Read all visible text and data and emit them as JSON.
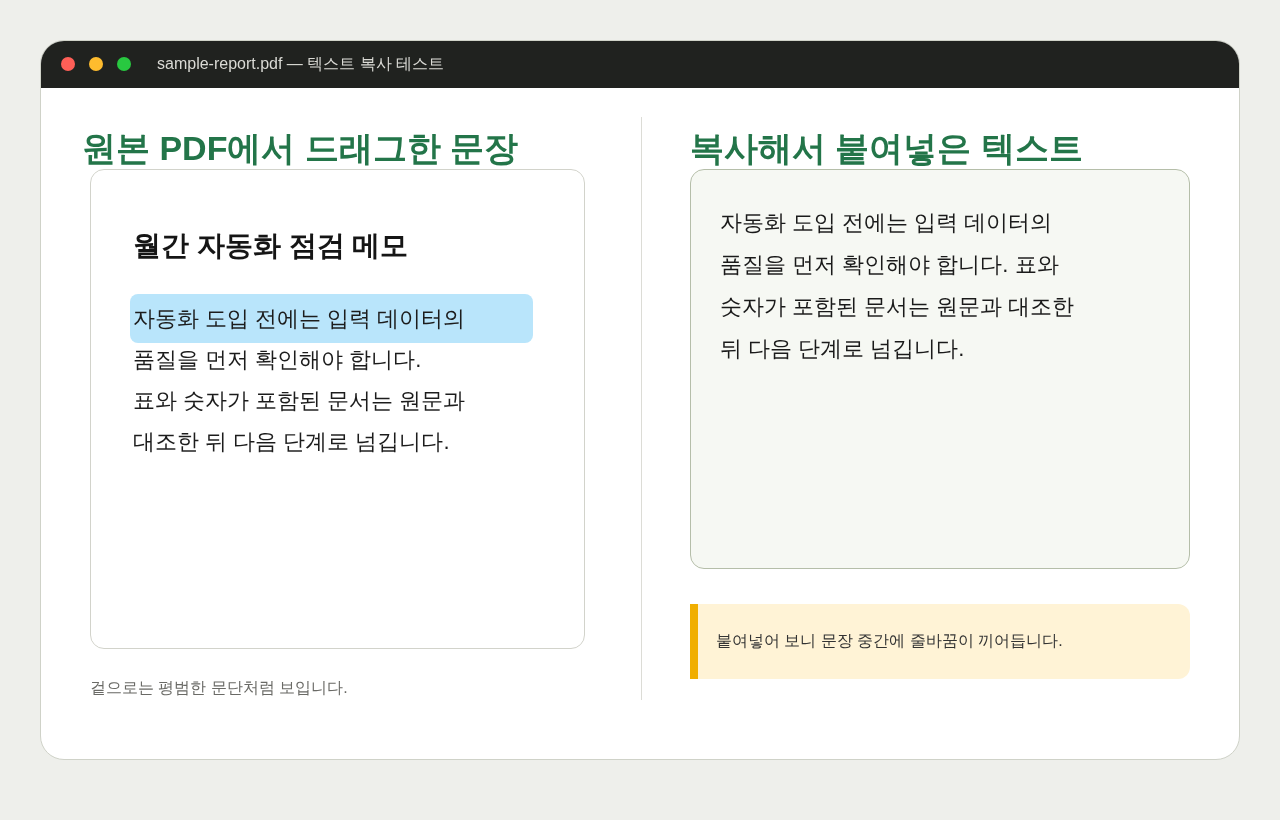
{
  "window": {
    "title": "sample-report.pdf — 텍스트 복사 테스트"
  },
  "source": {
    "heading": "원본 PDF에서 드래그한 문장",
    "document": {
      "title": "월간 자동화 점검 메모",
      "lines": [
        {
          "text": "자동화 도입 전에는 입력 데이터의",
          "selected": true
        },
        {
          "text": "품질을 먼저 확인해야 합니다.",
          "selected": false
        },
        {
          "text": "표와 숫자가 포함된 문서는 원문과",
          "selected": false
        },
        {
          "text": "대조한 뒤 다음 단계로 넘깁니다.",
          "selected": false
        }
      ]
    },
    "caption": "겉으로는 평범한 문단처럼 보입니다."
  },
  "pasted": {
    "heading": "복사해서 붙여넣은 텍스트",
    "lines": [
      "자동화 도입 전에는 입력 데이터의",
      "품질을 먼저 확인해야 합니다. 표와",
      "숫자가 포함된 문서는 원문과 대조한",
      "뒤 다음 단계로 넘깁니다."
    ],
    "note": "붙여넣어 보니 문장 중간에 줄바꿈이 끼어듭니다."
  }
}
